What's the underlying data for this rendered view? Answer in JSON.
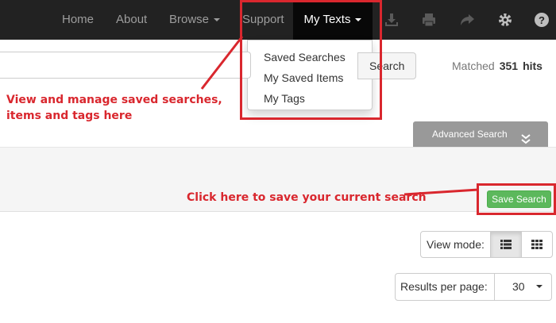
{
  "nav": {
    "home": "Home",
    "about": "About",
    "browse": "Browse",
    "support": "Support",
    "my_texts": "My Texts",
    "icons": [
      "download-icon",
      "print-icon",
      "share-icon",
      "gear-icon",
      "help-icon"
    ]
  },
  "dropdown": {
    "items": [
      "Saved Searches",
      "My Saved Items",
      "My Tags"
    ]
  },
  "search": {
    "input_value": "",
    "button_label": "Search",
    "matched_label": "Matched",
    "matched_count": "351",
    "matched_suffix": "hits"
  },
  "advanced_search": {
    "label": "Advanced Search"
  },
  "save_search": {
    "label": "Save Search"
  },
  "annotations": {
    "note_my_texts": "View and manage saved searches, items and tags here",
    "note_save": "Click here to save your current search"
  },
  "view_mode": {
    "label": "View mode:",
    "selected": "list"
  },
  "results_per_page": {
    "label": "Results per page:",
    "value": "30"
  },
  "colors": {
    "navbar": "#222222",
    "annotation_red": "#d9272e",
    "save_green": "#5cb85c",
    "advanced_grey": "#999999"
  }
}
